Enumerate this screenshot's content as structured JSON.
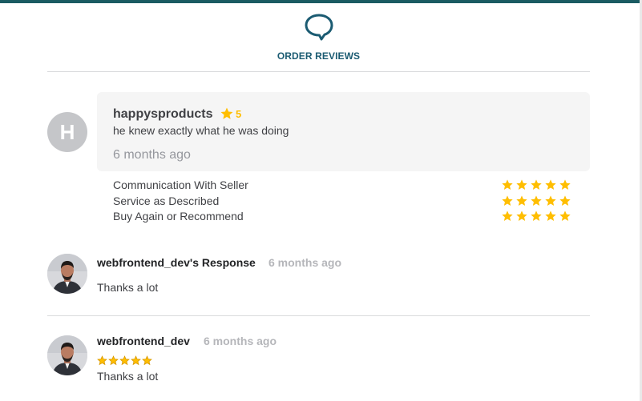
{
  "header": {
    "title": "ORDER REVIEWS",
    "icon": "speech-bubble-icon",
    "accent_color": "#1b5b72"
  },
  "review": {
    "avatar_letter": "H",
    "reviewer_name": "happysproducts",
    "rating": "5",
    "text": "he knew exactly what he was doing",
    "time": "6 months ago",
    "star_color": "#ffbe00"
  },
  "criteria": [
    {
      "label": "Communication With Seller",
      "stars": 5
    },
    {
      "label": "Service as Described",
      "stars": 5
    },
    {
      "label": "Buy Again or Recommend",
      "stars": 5
    }
  ],
  "seller_response": {
    "name": "webfrontend_dev's Response",
    "time": "6 months ago",
    "text": "Thanks a lot"
  },
  "seller_review": {
    "name": "webfrontend_dev",
    "time": "6 months ago",
    "stars": 5,
    "text": "Thanks a lot"
  }
}
